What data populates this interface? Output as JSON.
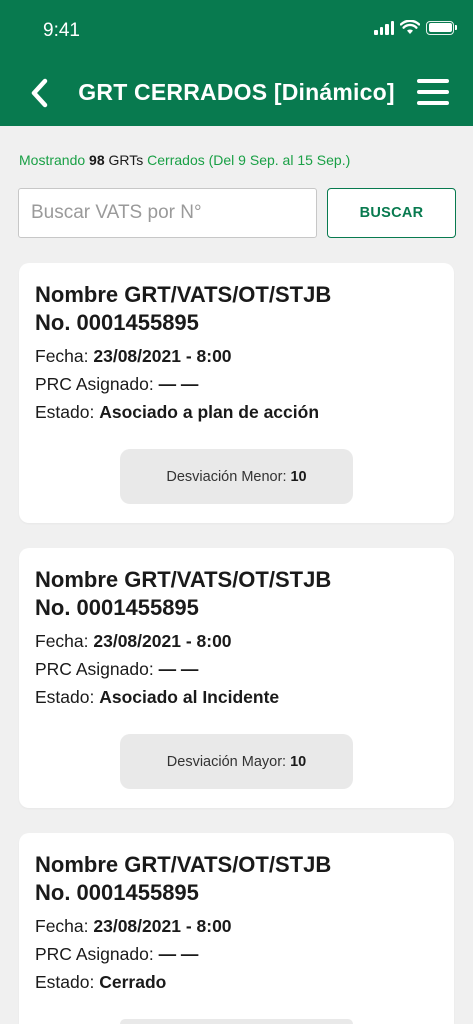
{
  "status_bar": {
    "time": "9:41"
  },
  "header": {
    "title": "GRT CERRADOS [Dinámico]"
  },
  "summary": {
    "prefix": "Mostrando",
    "count": "98",
    "unit": "GRTs",
    "suffix": "Cerrados (Del 9 Sep. al 15 Sep.)"
  },
  "search": {
    "placeholder": "Buscar VATS por N°",
    "button_label": "BUSCAR"
  },
  "cards": [
    {
      "title_line1": "Nombre GRT/VATS/OT/STJB",
      "title_line2": "No. 0001455895",
      "fecha_label": "Fecha:",
      "fecha_value": "23/08/2021 - 8:00",
      "prc_label": "PRC Asignado:",
      "prc_value": "— —",
      "estado_label": "Estado:",
      "estado_value": "Asociado a plan de acción",
      "pill_label": "Desviación Menor:",
      "pill_value": "10"
    },
    {
      "title_line1": "Nombre GRT/VATS/OT/STJB",
      "title_line2": "No. 0001455895",
      "fecha_label": "Fecha:",
      "fecha_value": "23/08/2021 - 8:00",
      "prc_label": "PRC Asignado:",
      "prc_value": "— —",
      "estado_label": "Estado:",
      "estado_value": "Asociado al Incidente",
      "pill_label": "Desviación Mayor:",
      "pill_value": "10"
    },
    {
      "title_line1": "Nombre GRT/VATS/OT/STJB",
      "title_line2": "No. 0001455895",
      "fecha_label": "Fecha:",
      "fecha_value": "23/08/2021 - 8:00",
      "prc_label": "PRC Asignado:",
      "prc_value": "— —",
      "estado_label": "Estado:",
      "estado_value": "Cerrado"
    }
  ],
  "colors": {
    "brand": "#087a4f",
    "accent_text": "#1aa046",
    "background": "#f0f0f0"
  },
  "icons": {
    "back": "chevron-left-icon",
    "menu": "hamburger-menu-icon"
  }
}
